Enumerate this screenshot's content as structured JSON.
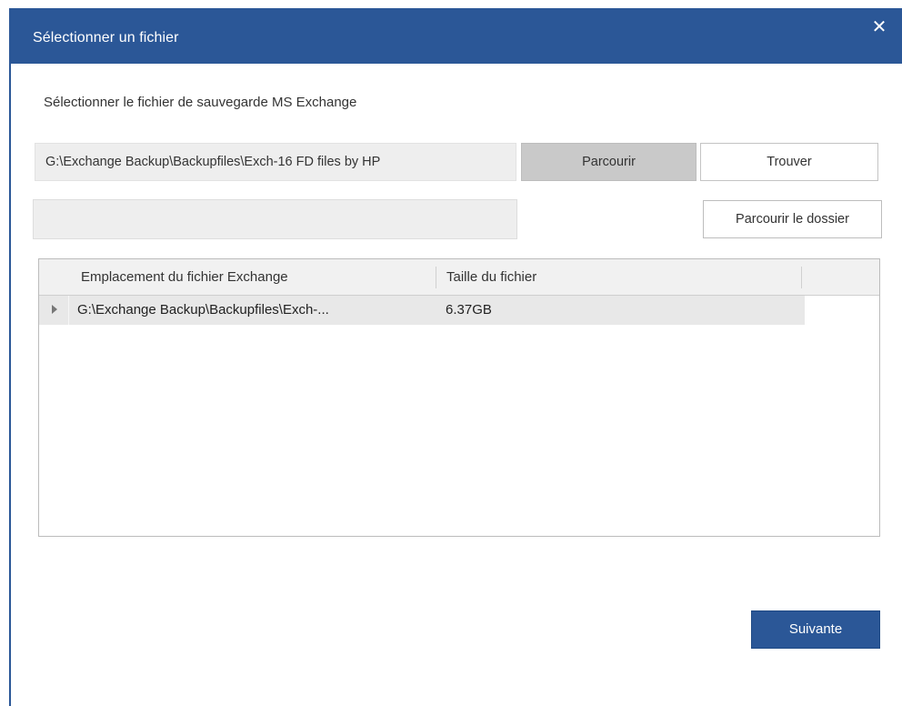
{
  "window": {
    "title": "Sélectionner un fichier",
    "close_glyph": "✕",
    "accent_color": "#2b5797"
  },
  "instruction": "Sélectionner le fichier de sauvegarde MS Exchange",
  "path_field": {
    "value": "G:\\Exchange Backup\\Backupfiles\\Exch-16 FD files by HP"
  },
  "buttons": {
    "browse": "Parcourir",
    "find": "Trouver",
    "browse_folder": "Parcourir le dossier",
    "next": "Suivante"
  },
  "folder_field": {
    "value": ""
  },
  "grid": {
    "columns": [
      "Emplacement du fichier Exchange",
      "Taille du fichier"
    ],
    "rows": [
      {
        "path": "G:\\Exchange Backup\\Backupfiles\\Exch-...",
        "size": "6.37GB"
      }
    ]
  },
  "icons": {
    "close": "close-icon",
    "row_expander": "triangle-right-icon"
  }
}
